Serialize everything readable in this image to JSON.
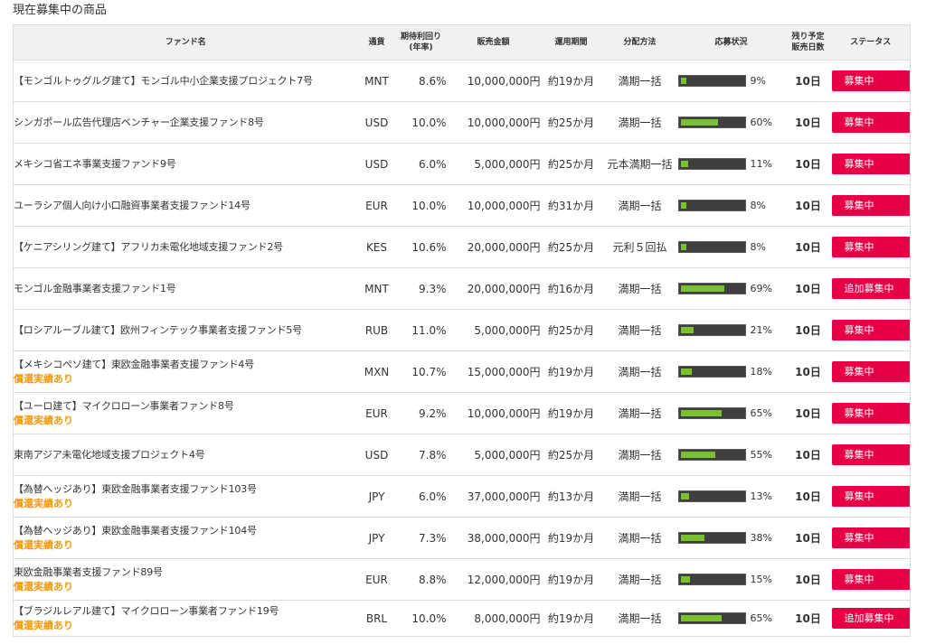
{
  "page_title": "現在募集中の商品",
  "headers": {
    "fund_name": "ファンド名",
    "currency": "通貨",
    "expected_yield_line1": "期待利回り",
    "expected_yield_line2": "(年率)",
    "sales_amount": "販売金額",
    "operation_period": "運用期間",
    "distribution_method": "分配方法",
    "application_status": "応募状況",
    "remaining_days_line1": "残り予定",
    "remaining_days_line2": "販売日数",
    "status": "ステータス"
  },
  "colors": {
    "accent": "#e60046",
    "progress_fill": "#7bc12d",
    "progress_track": "#3f3f3f",
    "note": "#f39c12",
    "header_bg": "#f1f1f1"
  },
  "funds": [
    {
      "name": "【モンゴルトゥグルグ建て】モンゴル中小企業支援プロジェクト7号",
      "note": "",
      "currency": "MNT",
      "rate": "8.6%",
      "amount": "10,000,000円",
      "period": "約19か月",
      "method": "満期一括",
      "progress": 9,
      "progress_label": "9%",
      "days": "10日",
      "status": "募集中"
    },
    {
      "name": "シンガポール広告代理店ベンチャー企業支援ファンド8号",
      "note": "",
      "currency": "USD",
      "rate": "10.0%",
      "amount": "10,000,000円",
      "period": "約25か月",
      "method": "満期一括",
      "progress": 60,
      "progress_label": "60%",
      "days": "10日",
      "status": "募集中"
    },
    {
      "name": "メキシコ省エネ事業支援ファンド9号",
      "note": "",
      "currency": "USD",
      "rate": "6.0%",
      "amount": "5,000,000円",
      "period": "約25か月",
      "method": "元本満期一括",
      "progress": 11,
      "progress_label": "11%",
      "days": "10日",
      "status": "募集中"
    },
    {
      "name": "ユーラシア個人向け小口融資事業者支援ファンド14号",
      "note": "",
      "currency": "EUR",
      "rate": "10.0%",
      "amount": "10,000,000円",
      "period": "約31か月",
      "method": "満期一括",
      "progress": 8,
      "progress_label": "8%",
      "days": "10日",
      "status": "募集中"
    },
    {
      "name": "【ケニアシリング建て】アフリカ未電化地域支援ファンド2号",
      "note": "",
      "currency": "KES",
      "rate": "10.6%",
      "amount": "20,000,000円",
      "period": "約25か月",
      "method": "元利５回払",
      "progress": 8,
      "progress_label": "8%",
      "days": "10日",
      "status": "募集中"
    },
    {
      "name": "モンゴル金融事業者支援ファンド1号",
      "note": "",
      "currency": "MNT",
      "rate": "9.3%",
      "amount": "20,000,000円",
      "period": "約16か月",
      "method": "満期一括",
      "progress": 69,
      "progress_label": "69%",
      "days": "10日",
      "status": "追加募集中"
    },
    {
      "name": "【ロシアルーブル建て】欧州フィンテック事業者支援ファンド5号",
      "note": "",
      "currency": "RUB",
      "rate": "11.0%",
      "amount": "5,000,000円",
      "period": "約25か月",
      "method": "満期一括",
      "progress": 21,
      "progress_label": "21%",
      "days": "10日",
      "status": "募集中"
    },
    {
      "name": "【メキシコペソ建て】東欧金融事業者支援ファンド4号",
      "note": "償還実績あり",
      "currency": "MXN",
      "rate": "10.7%",
      "amount": "15,000,000円",
      "period": "約19か月",
      "method": "満期一括",
      "progress": 18,
      "progress_label": "18%",
      "days": "10日",
      "status": "募集中"
    },
    {
      "name": "【ユーロ建て】マイクロローン事業者ファンド8号",
      "note": "償還実績あり",
      "currency": "EUR",
      "rate": "9.2%",
      "amount": "10,000,000円",
      "period": "約19か月",
      "method": "満期一括",
      "progress": 65,
      "progress_label": "65%",
      "days": "10日",
      "status": "募集中"
    },
    {
      "name": "東南アジア未電化地域支援プロジェクト4号",
      "note": "",
      "currency": "USD",
      "rate": "7.8%",
      "amount": "5,000,000円",
      "period": "約25か月",
      "method": "満期一括",
      "progress": 55,
      "progress_label": "55%",
      "days": "10日",
      "status": "募集中"
    },
    {
      "name": "【為替ヘッジあり】東欧金融事業者支援ファンド103号",
      "note": "償還実績あり",
      "currency": "JPY",
      "rate": "6.0%",
      "amount": "37,000,000円",
      "period": "約13か月",
      "method": "満期一括",
      "progress": 13,
      "progress_label": "13%",
      "days": "10日",
      "status": "募集中"
    },
    {
      "name": "【為替ヘッジあり】東欧金融事業者支援ファンド104号",
      "note": "償還実績あり",
      "currency": "JPY",
      "rate": "7.3%",
      "amount": "38,000,000円",
      "period": "約19か月",
      "method": "満期一括",
      "progress": 38,
      "progress_label": "38%",
      "days": "10日",
      "status": "募集中"
    },
    {
      "name": "東欧金融事業者支援ファンド89号",
      "note": "償還実績あり",
      "currency": "EUR",
      "rate": "8.8%",
      "amount": "12,000,000円",
      "period": "約19か月",
      "method": "満期一括",
      "progress": 15,
      "progress_label": "15%",
      "days": "10日",
      "status": "募集中"
    },
    {
      "name": "【ブラジルレアル建て】マイクロローン事業者ファンド19号",
      "note": "償還実績あり",
      "currency": "BRL",
      "rate": "10.0%",
      "amount": "8,000,000円",
      "period": "約19か月",
      "method": "満期一括",
      "progress": 65,
      "progress_label": "65%",
      "days": "10日",
      "status": "追加募集中"
    }
  ]
}
